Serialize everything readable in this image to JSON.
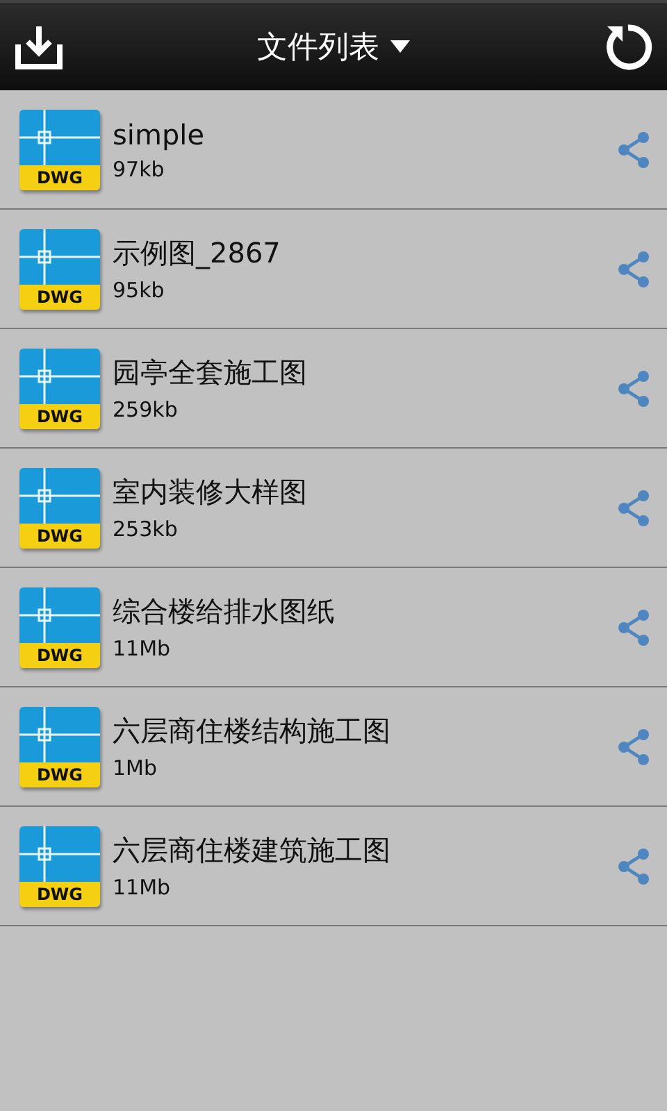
{
  "app_bar": {
    "title": "文件列表"
  },
  "files": [
    {
      "name": "simple",
      "size": "97kb",
      "badge": "DWG"
    },
    {
      "name": "示例图_2867",
      "size": "95kb",
      "badge": "DWG"
    },
    {
      "name": "园亭全套施工图",
      "size": "259kb",
      "badge": "DWG"
    },
    {
      "name": "室内装修大样图",
      "size": "253kb",
      "badge": "DWG"
    },
    {
      "name": "综合楼给排水图纸",
      "size": "11Mb",
      "badge": "DWG"
    },
    {
      "name": "六层商住楼结构施工图",
      "size": "1Mb",
      "badge": "DWG"
    },
    {
      "name": "六层商住楼建筑施工图",
      "size": "11Mb",
      "badge": "DWG"
    }
  ]
}
